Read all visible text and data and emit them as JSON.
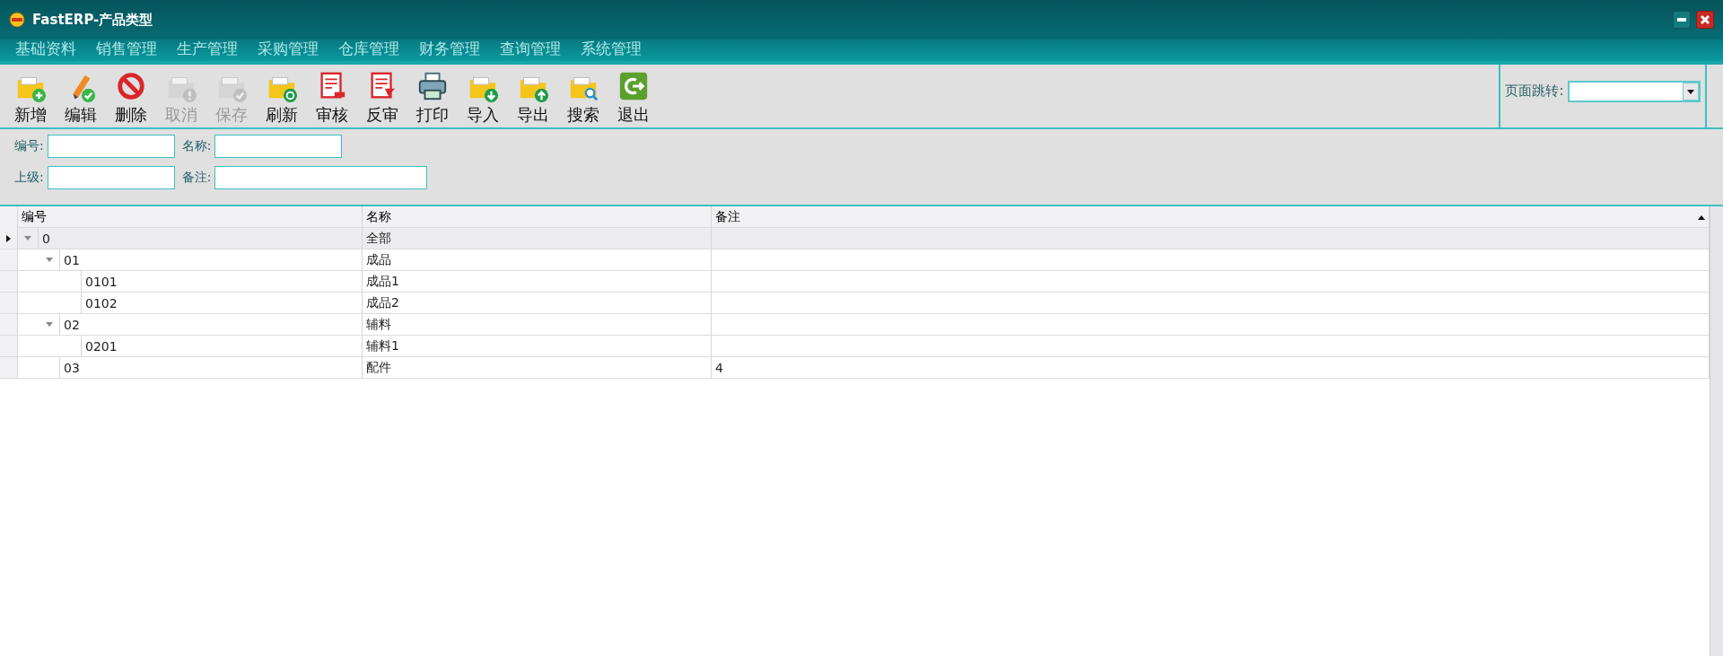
{
  "window": {
    "title": "FastERP-产品类型"
  },
  "menu": [
    "基础资料",
    "销售管理",
    "生产管理",
    "采购管理",
    "仓库管理",
    "财务管理",
    "查询管理",
    "系统管理"
  ],
  "toolbar": [
    {
      "label": "新增",
      "kind": "add",
      "disabled": false
    },
    {
      "label": "编辑",
      "kind": "edit",
      "disabled": false
    },
    {
      "label": "删除",
      "kind": "delete",
      "disabled": false
    },
    {
      "label": "取消",
      "kind": "cancel",
      "disabled": true
    },
    {
      "label": "保存",
      "kind": "save",
      "disabled": true
    },
    {
      "label": "刷新",
      "kind": "refresh",
      "disabled": false
    },
    {
      "label": "审核",
      "kind": "audit",
      "disabled": false
    },
    {
      "label": "反审",
      "kind": "unaudit",
      "disabled": false
    },
    {
      "label": "打印",
      "kind": "print",
      "disabled": false
    },
    {
      "label": "导入",
      "kind": "import",
      "disabled": false
    },
    {
      "label": "导出",
      "kind": "export",
      "disabled": false
    },
    {
      "label": "搜索",
      "kind": "search",
      "disabled": false
    },
    {
      "label": "退出",
      "kind": "exit",
      "disabled": false
    }
  ],
  "page_jump": {
    "label": "页面跳转:"
  },
  "filters": [
    [
      {
        "label": "编号:",
        "wide": false
      },
      {
        "label": "名称:",
        "wide": false
      }
    ],
    [
      {
        "label": "上级:",
        "wide": false
      },
      {
        "label": "备注:",
        "wide": true
      }
    ]
  ],
  "table": {
    "columns": [
      "编号",
      "名称",
      "备注"
    ],
    "rows": [
      {
        "code": "0",
        "name": "全部",
        "selected": true,
        "expanded": true,
        "children": [
          {
            "code": "01",
            "name": "成品",
            "selected": false,
            "expanded": true,
            "children": [
              {
                "code": "0101",
                "name": "成品1",
                "selected": false
              },
              {
                "code": "0102",
                "name": "成品2",
                "selected": false
              }
            ]
          },
          {
            "code": "02",
            "name": "辅料",
            "selected": false,
            "expanded": true,
            "children": [
              {
                "code": "0201",
                "name": "辅料1",
                "selected": false
              }
            ]
          },
          {
            "code": "03",
            "name": "配件",
            "note": "4",
            "selected": false
          }
        ]
      }
    ]
  }
}
